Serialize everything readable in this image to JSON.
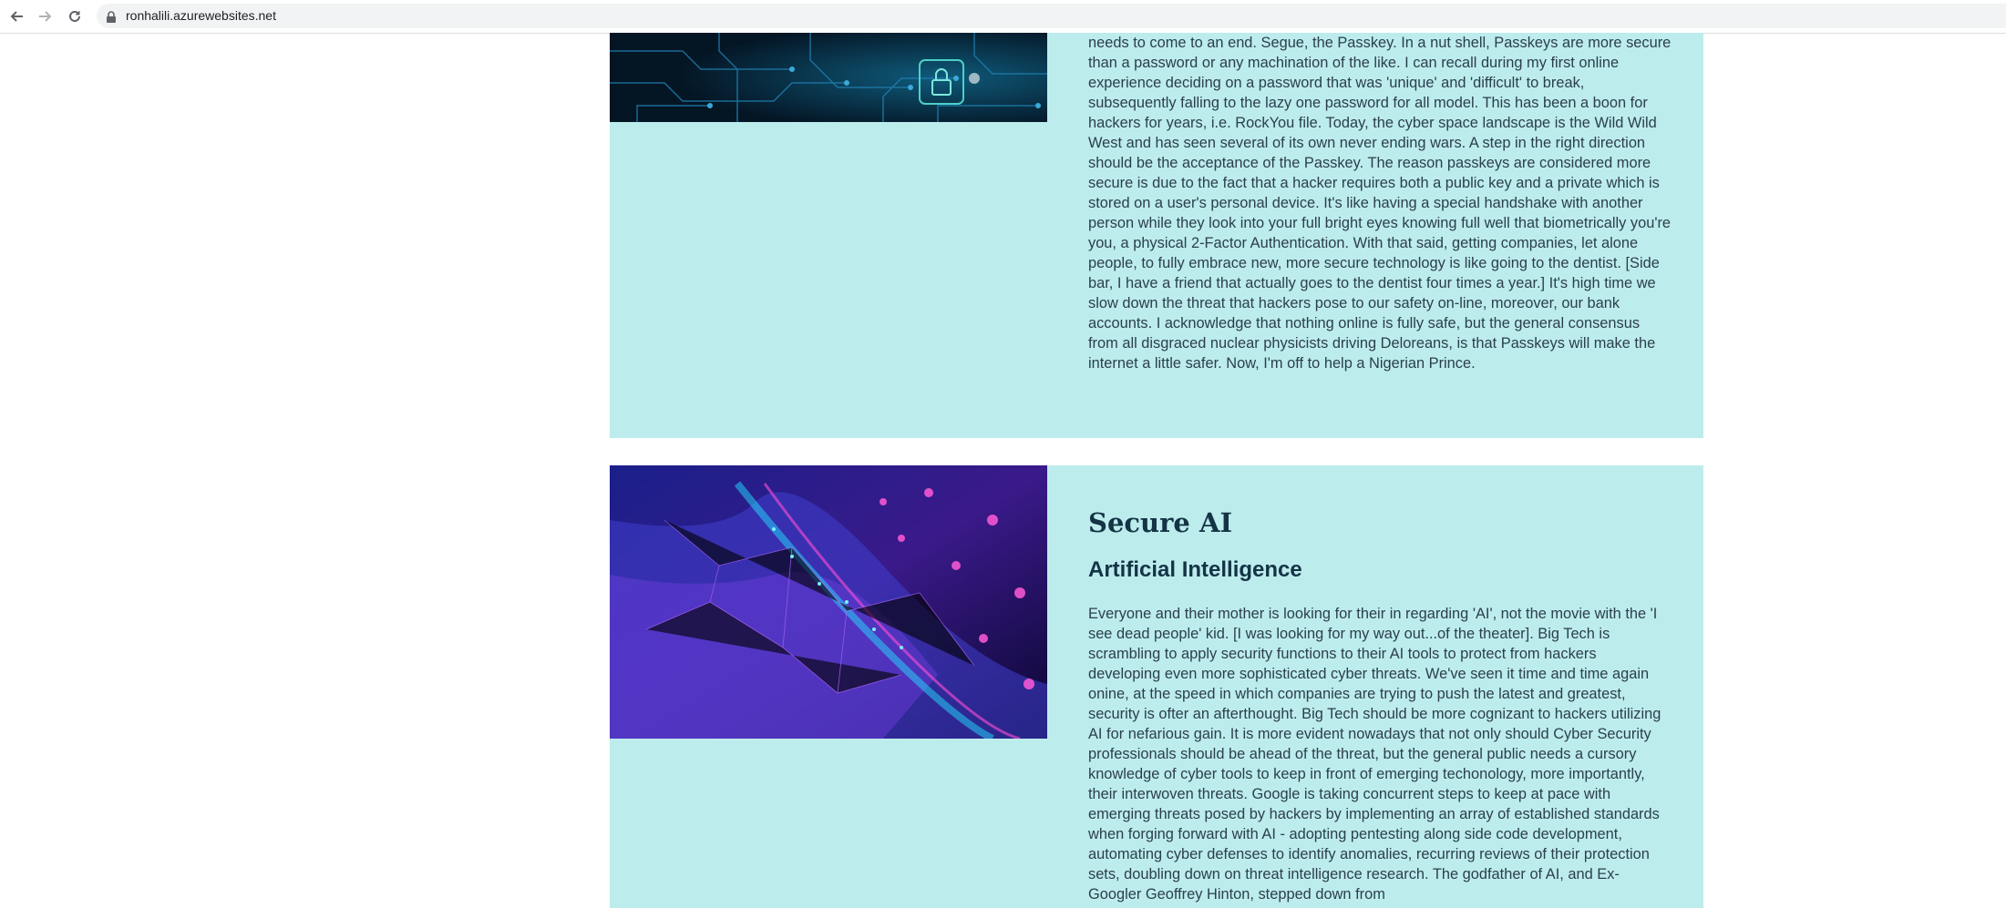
{
  "browser": {
    "url": "ronhalili.azurewebsites.net"
  },
  "posts": [
    {
      "image_icon": "circuit-lock-image",
      "body": "needs to come to an end. Segue, the Passkey. In a nut shell, Passkeys are more secure than a password or any machination of the like. I can recall during my first online experience deciding on a password that was 'unique' and 'difficult' to break, subsequently falling to the lazy one password for all model. This has been a boon for hackers for years, i.e. RockYou file. Today, the cyber space landscape is the Wild Wild West and has seen several of its own never ending wars. A step in the right direction should be the acceptance of the Passkey. The reason passkeys are considered more secure is due to the fact that a hacker requires both a public key and a private which is stored on a user's personal device. It's like having a special handshake with another person while they look into your full bright eyes knowing full well that biometrically you're you, a physical 2-Factor Authentication. With that said, getting companies, let alone people, to fully embrace new, more secure technology is like going to the dentist. [Side bar, I have a friend that actually goes to the dentist four times a year.] It's high time we slow down the threat that hackers pose to our safety on-line, moreover, our bank accounts. I acknowledge that nothing online is fully safe, but the general consensus from all disgraced nuclear physicists driving Deloreans, is that Passkeys will make the internet a little safer. Now, I'm off to help a Nigerian Prince."
    },
    {
      "image_icon": "ai-network-image",
      "title": "Secure AI",
      "subtitle": "Artificial Intelligence",
      "body": "Everyone and their mother is looking for their in regarding 'AI', not the movie with the 'I see dead people' kid. [I was looking for my way out...of the theater]. Big Tech is scrambling to apply security functions to their AI tools to protect from hackers developing even more sophisticated cyber threats. We've seen it time and time again onine, at the speed in which companies are trying to push the latest and greatest, security is ofter an afterthought. Big Tech should be more cognizant to hackers utilizing AI for nefarious gain. It is more evident nowadays that not only should Cyber Security professionals should be ahead of the threat, but the general public needs a cursory knowledge of cyber tools to keep in front of emerging techonology, more importantly, their interwoven threats. Google is taking concurrent steps to keep at pace with emerging threats posed by hackers by implementing an array of established standards when forging forward with AI - adopting pentesting along side code development, automating cyber defenses to identify anomalies, recurring reviews of their protection sets, doubling down on threat intelligence research. The godfather of AI, and Ex-Googler Geoffrey Hinton, stepped down from"
    }
  ]
}
